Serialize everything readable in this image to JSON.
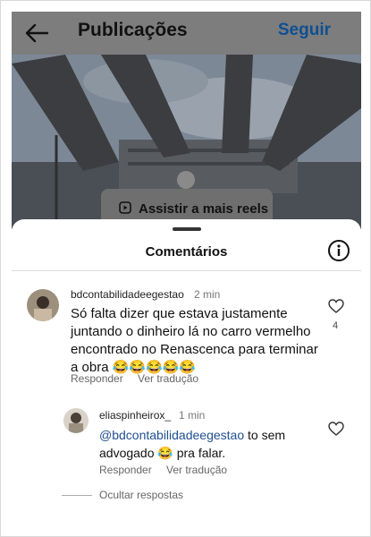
{
  "header": {
    "title": "Publicações",
    "follow_label": "Seguir"
  },
  "reels_button": {
    "label": "Assistir a mais reels"
  },
  "comments_sheet": {
    "title": "Comentários",
    "comments": [
      {
        "username": "bdcontabilidadeegestao",
        "time": "2 min",
        "text": "Só falta dizer que estava justamente juntando o dinheiro lá no carro vermelho encontrado no Renascenca para terminar a obra 😂😂😂😂😂",
        "likes": "4",
        "reply_label": "Responder",
        "translate_label": "Ver tradução",
        "replies": [
          {
            "username": "eliaspinheirox_",
            "time": "1 min",
            "mention": "@bdcontabilidadeegestao",
            "text_after_mention": " to sem advogado 😂 pra falar.",
            "reply_label": "Responder",
            "translate_label": "Ver tradução"
          }
        ]
      }
    ],
    "hide_replies_label": "Ocultar respostas"
  },
  "colors": {
    "link_blue": "#0f4f91",
    "overlay_gray": "#7d7d7d"
  }
}
